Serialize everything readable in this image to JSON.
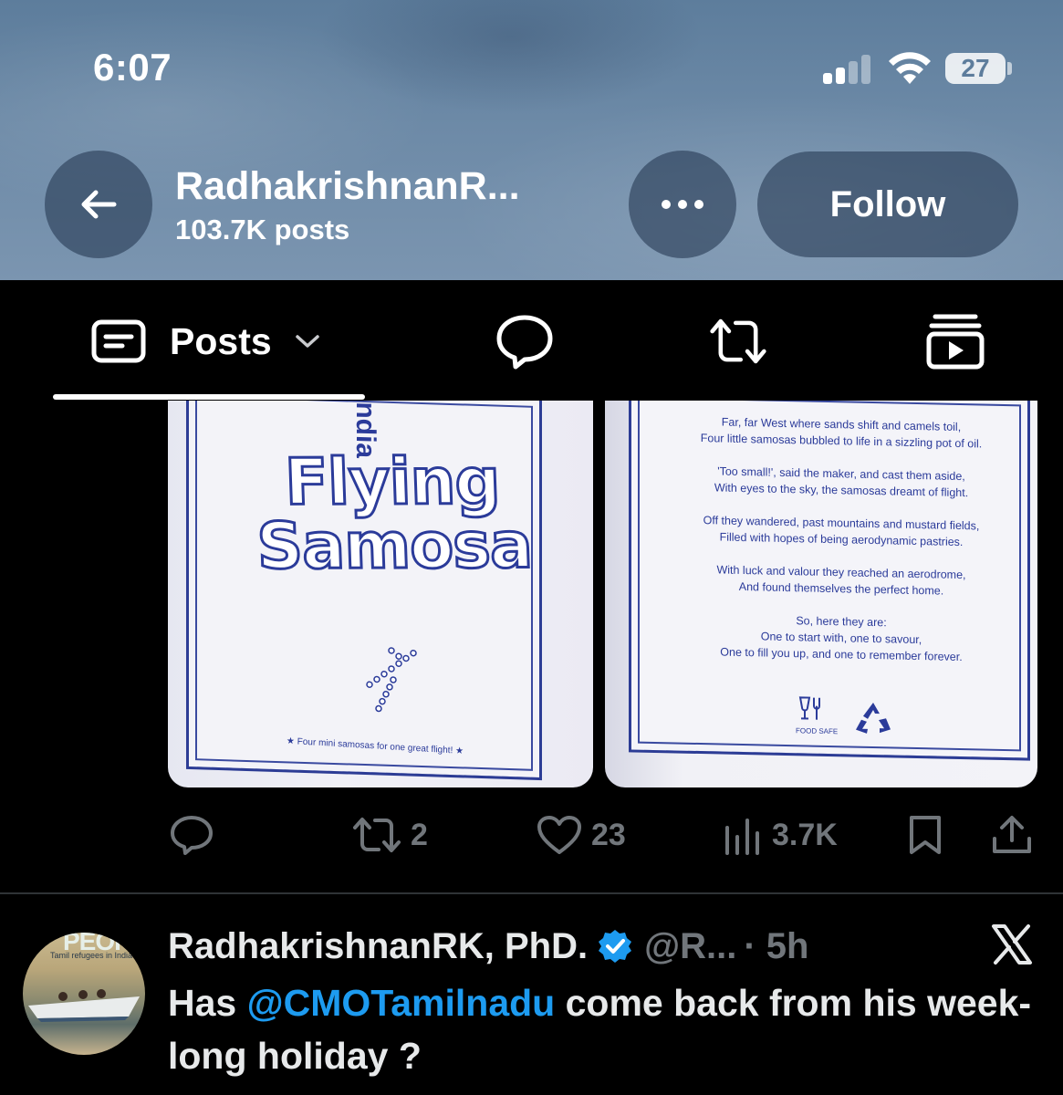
{
  "status_bar": {
    "time": "6:07",
    "battery_level": "27",
    "signal_bars_filled": 2,
    "signal_bars_total": 4
  },
  "header": {
    "profile_name": "RadhakrishnanR...",
    "post_count": "103.7K posts",
    "follow_label": "Follow",
    "back_icon": "arrow-left-icon",
    "more_icon": "ellipsis-icon"
  },
  "tabs": {
    "active_label": "Posts",
    "items": [
      "posts",
      "replies",
      "reposts",
      "media"
    ]
  },
  "post": {
    "media_left": {
      "brand": "India",
      "title_line1": "Flying",
      "title_line2": "Samosa",
      "footer": "★ Four mini samosas for one great flight! ★"
    },
    "media_right": {
      "poem": [
        [
          "Far, far West where sands shift and camels toil,",
          "Four little samosas bubbled to life in a sizzling pot of oil."
        ],
        [
          "'Too small!', said the maker, and cast them aside,",
          "With eyes to the sky, the samosas dreamt of flight."
        ],
        [
          "Off they wandered, past mountains and mustard fields,",
          "Filled with hopes of being aerodynamic pastries."
        ],
        [
          "With luck and valour they reached an aerodrome,",
          "And found themselves the perfect home."
        ],
        [
          "So, here they are:",
          "One to start with, one to savour,",
          "One to fill you up, and one to remember forever."
        ]
      ],
      "food_safe_label": "FOOD SAFE"
    },
    "actions": {
      "reply_count": "",
      "repost_count": "2",
      "like_count": "23",
      "view_count": "3.7K"
    }
  },
  "next_tweet": {
    "avatar_text": "PEOPLE",
    "avatar_subtext": "Tamil refugees in India",
    "author_name": "RadhakrishnanRK, PhD.",
    "handle": "@R...",
    "time": "· 5h",
    "text_prefix": "Has ",
    "mention": "@CMOTamilnadu",
    "text_suffix": " come back from his week-long holiday ?"
  },
  "colors": {
    "accent_blue": "#1d9bf0",
    "muted_gray": "#71767b",
    "header_bg": "#6d8aa7",
    "card_ink": "#2b3b9a"
  }
}
